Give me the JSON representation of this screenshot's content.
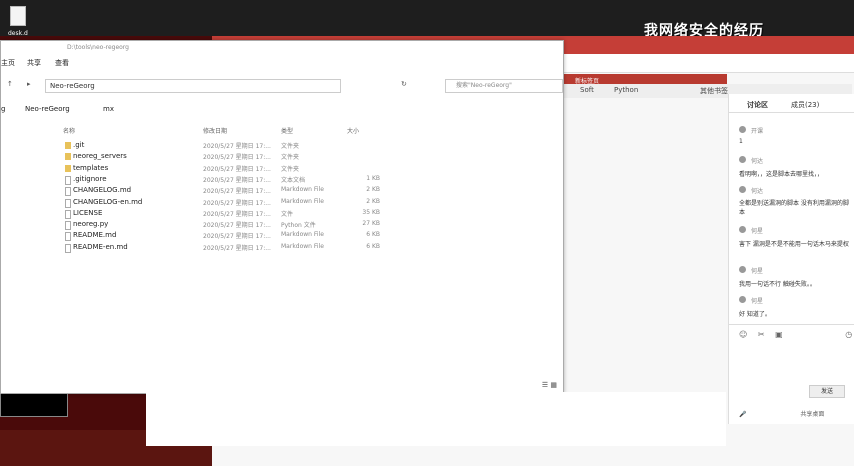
{
  "desktop": {
    "icon_label": "desk.d",
    "watermark": "我网络安全的经历"
  },
  "browser": {
    "tabs": [
      "",
      "",
      ""
    ],
    "bookmarks": [
      "Soft",
      "Python",
      "其他书签"
    ],
    "red_strip_label": "新标签页"
  },
  "chat": {
    "tab_discussion": "讨论区",
    "tab_members": "成员(23)",
    "messages": [
      {
        "name": "开课",
        "text": "1"
      },
      {
        "name": "何达",
        "text": "看明啊，，这是脚本去哪里找，，"
      },
      {
        "name": "何达",
        "text": "全都是别送漏洞的脚本 没有利用漏洞的脚本"
      },
      {
        "name": "何星",
        "text": "害下 漏洞是不是不能用一句话木马来提权"
      },
      {
        "name": "何星",
        "text": "我用一句话不行 触碰失败。。"
      },
      {
        "name": "何星",
        "text": "好 知道了。"
      }
    ],
    "send_label": "发送",
    "bottom_text": "共享桌面"
  },
  "explorer": {
    "title": "D:\\tools\\neo-regeorg",
    "menu": [
      "主页",
      "共享",
      "查看"
    ],
    "address": "Neo-reGeorg",
    "search_placeholder": "搜索\"Neo-reGeorg\"",
    "tabs": [
      "Neo-reGeorg",
      "mx"
    ],
    "columns": {
      "name": "名称",
      "date": "修改日期",
      "type": "类型",
      "size": "大小"
    },
    "files": [
      {
        "name": ".git",
        "date": "2020/5/27 星期日 17:...",
        "type": "文件夹",
        "size": "",
        "kind": "folder"
      },
      {
        "name": "neoreg_servers",
        "date": "2020/5/27 星期日 17:...",
        "type": "文件夹",
        "size": "",
        "kind": "folder"
      },
      {
        "name": "templates",
        "date": "2020/5/27 星期日 17:...",
        "type": "文件夹",
        "size": "",
        "kind": "folder"
      },
      {
        "name": ".gitignore",
        "date": "2020/5/27 星期日 17:...",
        "type": "文本文档",
        "size": "1 KB",
        "kind": "file"
      },
      {
        "name": "CHANGELOG.md",
        "date": "2020/5/27 星期日 17:...",
        "type": "Markdown File",
        "size": "2 KB",
        "kind": "file"
      },
      {
        "name": "CHANGELOG-en.md",
        "date": "2020/5/27 星期日 17:...",
        "type": "Markdown File",
        "size": "2 KB",
        "kind": "file"
      },
      {
        "name": "LICENSE",
        "date": "2020/5/27 星期日 17:...",
        "type": "文件",
        "size": "35 KB",
        "kind": "file"
      },
      {
        "name": "neoreg.py",
        "date": "2020/5/27 星期日 17:...",
        "type": "Python 文件",
        "size": "27 KB",
        "kind": "file"
      },
      {
        "name": "README.md",
        "date": "2020/5/27 星期日 17:...",
        "type": "Markdown File",
        "size": "6 KB",
        "kind": "file"
      },
      {
        "name": "README-en.md",
        "date": "2020/5/27 星期日 17:...",
        "type": "Markdown File",
        "size": "6 KB",
        "kind": "file"
      }
    ]
  }
}
